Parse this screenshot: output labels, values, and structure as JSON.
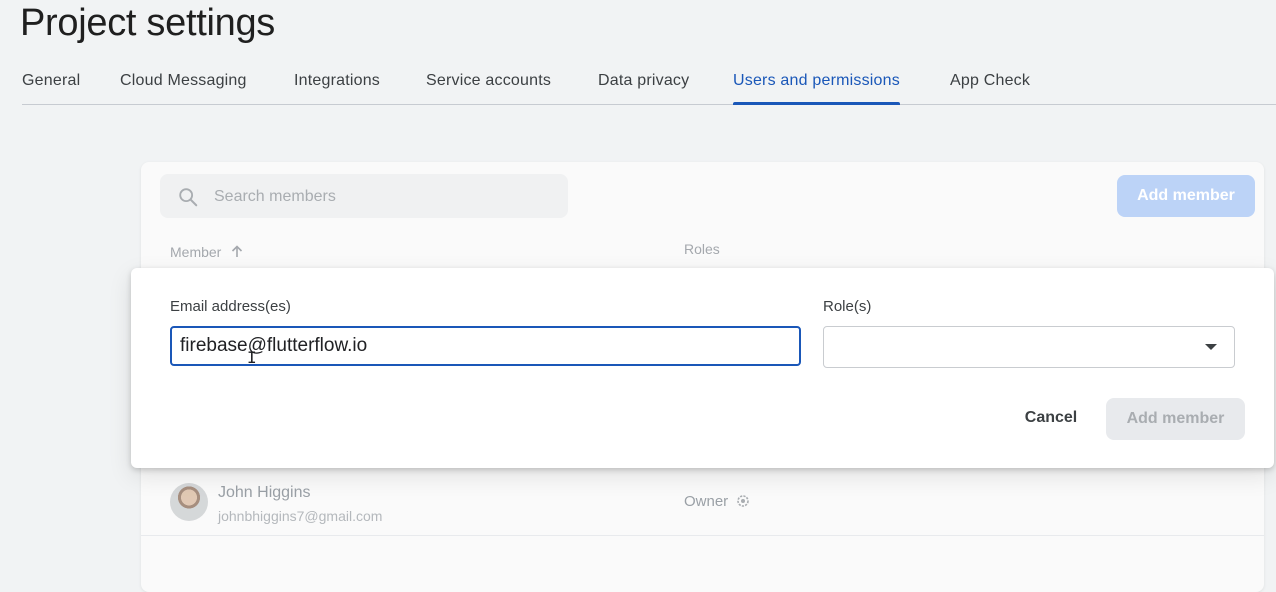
{
  "header": {
    "title": "Project settings"
  },
  "tabs": [
    {
      "label": "General"
    },
    {
      "label": "Cloud Messaging"
    },
    {
      "label": "Integrations"
    },
    {
      "label": "Service accounts"
    },
    {
      "label": "Data privacy"
    },
    {
      "label": "Users and permissions",
      "active": true
    },
    {
      "label": "App Check"
    }
  ],
  "members": {
    "search_placeholder": "Search members",
    "add_member_label": "Add member",
    "columns": {
      "member": "Member",
      "roles": "Roles"
    },
    "rows": [
      {
        "name": "John Higgins",
        "email": "johnbhiggins7@gmail.com",
        "role": "Owner"
      }
    ]
  },
  "dialog": {
    "email_label": "Email address(es)",
    "email_value": "firebase@flutterflow.io",
    "role_label": "Role(s)",
    "role_value": "",
    "cancel_label": "Cancel",
    "add_label": "Add member"
  },
  "colors": {
    "accent": "#1a57b8",
    "background": "#f1f3f4",
    "disabled_button": "#e8eaed",
    "add_member_top": "#bcd3f7"
  },
  "icons": {
    "search": "search-icon",
    "sort": "arrow-up-icon",
    "dropdown": "chevron-down-icon",
    "role_info": "gear-icon",
    "cursor": "text-cursor-icon"
  }
}
